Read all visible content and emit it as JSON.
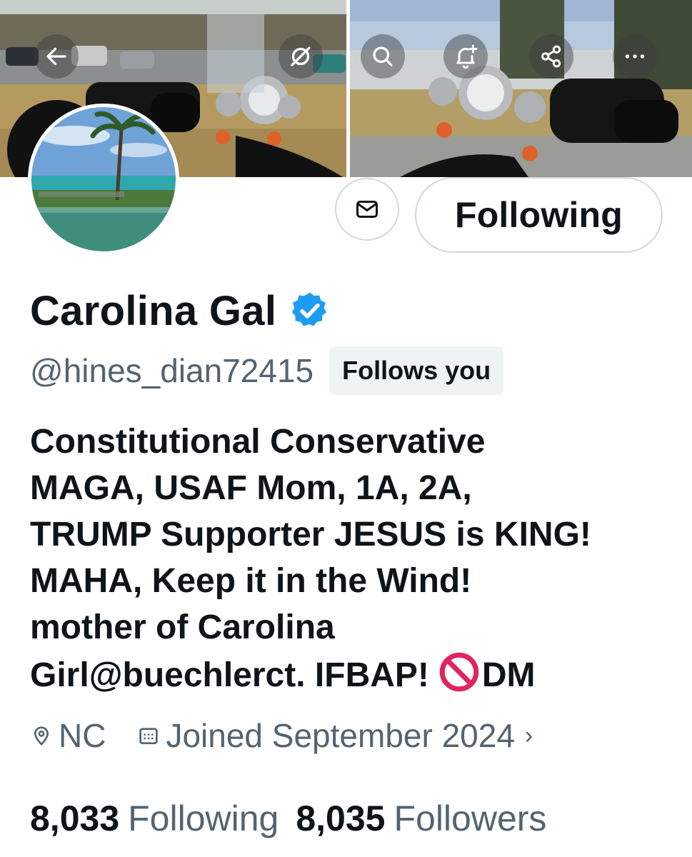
{
  "header": {
    "buttons": [
      {
        "name": "back-arrow-icon"
      },
      {
        "name": "grok-icon"
      },
      {
        "name": "search-icon"
      },
      {
        "name": "bell-plus-icon"
      },
      {
        "name": "share-icon"
      },
      {
        "name": "more-icon"
      }
    ]
  },
  "actions": {
    "message_icon": "envelope-icon",
    "following_label": "Following"
  },
  "profile": {
    "display_name": "Carolina Gal",
    "verified_color": "#1d9bf0",
    "handle": "@hines_dian72415",
    "follows_you": "Follows you",
    "bio_lines": [
      "Constitutional Conservative",
      "MAGA, USAF Mom, 1A, 2A,",
      "TRUMP Supporter JESUS is KING!",
      "MAHA, Keep it in the Wind!",
      "mother of Carolina"
    ],
    "bio_last_line_a": "Girl",
    "bio_mention": "@buechlerct",
    "bio_last_line_b": ". IFBAP!",
    "bio_emoji": "🚫",
    "bio_last_line_c": "DM",
    "location": "NC",
    "joined": "Joined September 2024"
  },
  "stats": {
    "following_count": "8,033",
    "following_label": "Following",
    "followers_count": "8,035",
    "followers_label": "Followers"
  }
}
